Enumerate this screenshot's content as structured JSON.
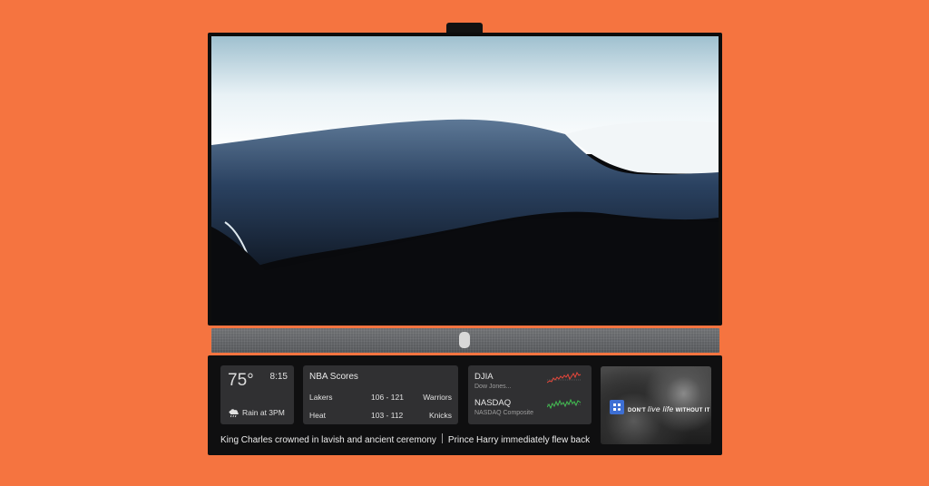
{
  "weather": {
    "temperature": "75°",
    "time": "8:15",
    "icon": "rain-cloud-icon",
    "forecast": "Rain at 3PM"
  },
  "scores": {
    "title": "NBA Scores",
    "games": [
      {
        "home": "Lakers",
        "score": "106 - 121",
        "away": "Warriors"
      },
      {
        "home": "Heat",
        "score": "103 - 112",
        "away": "Knicks"
      }
    ]
  },
  "stocks": [
    {
      "symbol": "DJIA",
      "name": "Dow Jones...",
      "trend_color": "#e5463a"
    },
    {
      "symbol": "NASDAQ",
      "name": "NASDAQ Composite",
      "trend_color": "#3fbf4f"
    }
  ],
  "promo": {
    "line_before": "DON'T",
    "line_emphasis": "live life",
    "line_after": "WITHOUT IT",
    "logo_icon": "app-logo-icon"
  },
  "ticker": {
    "headlines": [
      "King Charles crowned in lavish and ancient ceremony",
      "Prince Harry immediately flew back"
    ]
  },
  "colors": {
    "background": "#f57440",
    "card": "#303032",
    "panel": "#0f0f10"
  }
}
